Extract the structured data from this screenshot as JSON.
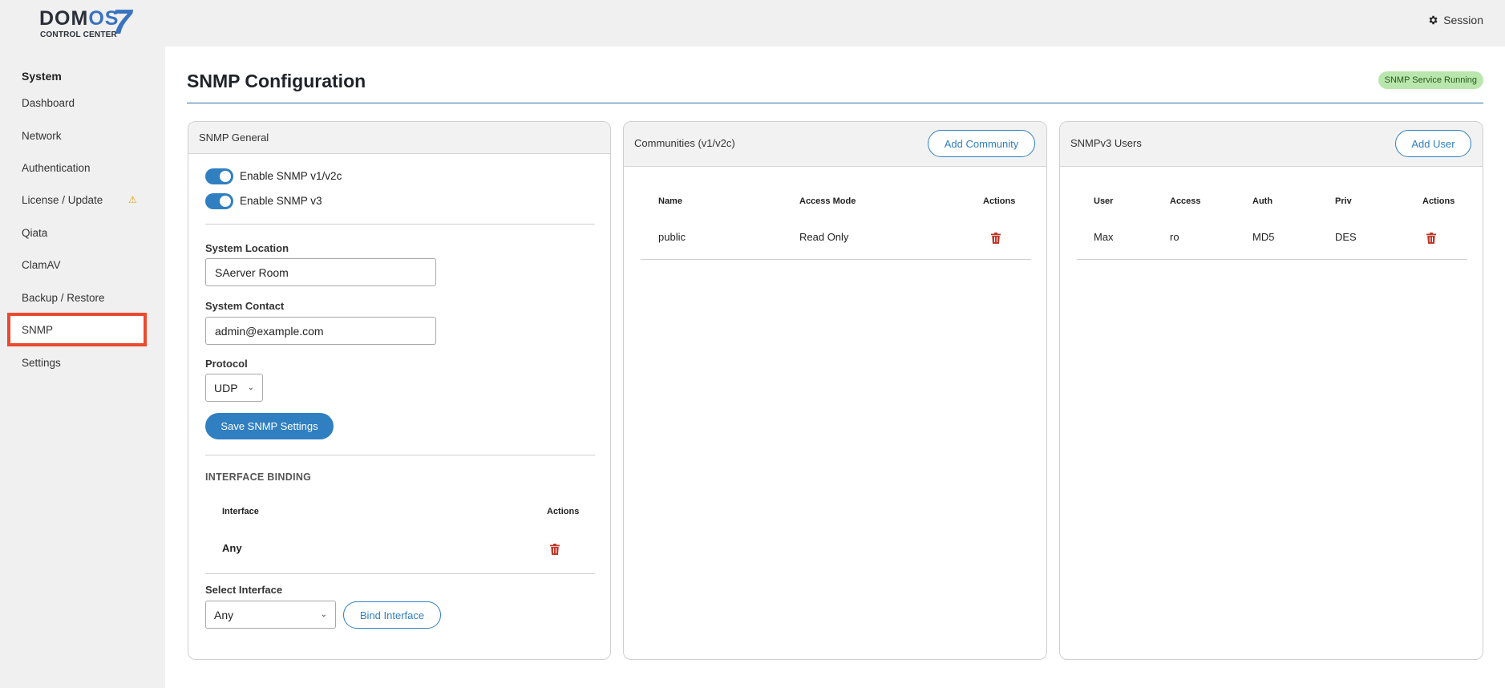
{
  "header": {
    "logo_text_a": "DOM",
    "logo_text_b": "OS",
    "logo_number": "7",
    "logo_subtitle": "CONTROL CENTER",
    "session_label": "Session"
  },
  "sidebar": {
    "heading": "System",
    "items": [
      {
        "label": "Dashboard"
      },
      {
        "label": "Network"
      },
      {
        "label": "Authentication"
      },
      {
        "label": "License / Update",
        "warning": "⚠"
      },
      {
        "label": "Qiata"
      },
      {
        "label": "ClamAV"
      },
      {
        "label": "Backup / Restore"
      },
      {
        "label": "SNMP"
      },
      {
        "label": "Settings"
      }
    ]
  },
  "page": {
    "title": "SNMP Configuration",
    "status_badge": "SNMP Service Running"
  },
  "general": {
    "title": "SNMP General",
    "toggle_v1v2c": "Enable SNMP v1/v2c",
    "toggle_v3": "Enable SNMP v3",
    "location_label": "System Location",
    "location_value": "SAerver Room",
    "contact_label": "System Contact",
    "contact_value": "admin@example.com",
    "protocol_label": "Protocol",
    "protocol_value": "UDP",
    "save_label": "Save SNMP Settings",
    "binding_title": "INTERFACE BINDING",
    "binding_col_interface": "Interface",
    "binding_col_actions": "Actions",
    "binding_rows": [
      {
        "interface": "Any"
      }
    ],
    "select_interface_label": "Select Interface",
    "select_interface_value": "Any",
    "bind_label": "Bind Interface"
  },
  "communities": {
    "title": "Communities (v1/v2c)",
    "add_label": "Add Community",
    "col_name": "Name",
    "col_access": "Access Mode",
    "col_actions": "Actions",
    "rows": [
      {
        "name": "public",
        "access": "Read Only"
      }
    ]
  },
  "users": {
    "title": "SNMPv3 Users",
    "add_label": "Add User",
    "col_user": "User",
    "col_access": "Access",
    "col_auth": "Auth",
    "col_priv": "Priv",
    "col_actions": "Actions",
    "rows": [
      {
        "user": "Max",
        "access": "ro",
        "auth": "MD5",
        "priv": "DES"
      }
    ]
  },
  "colors": {
    "accent": "#2f7fc1",
    "danger": "#c0392b",
    "highlight": "#ea4a2f",
    "badge_bg": "#b9e6ad"
  }
}
